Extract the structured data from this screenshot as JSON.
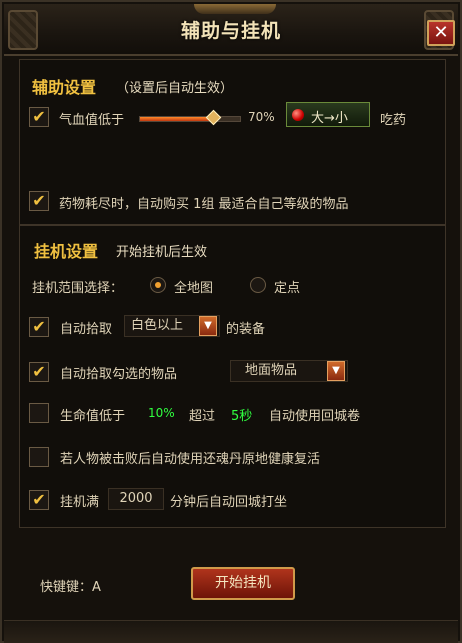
{
  "window": {
    "title": "辅助与挂机",
    "close_glyph": "✕"
  },
  "assist": {
    "section_title": "辅助设置",
    "section_note": "（设置后自动生效）",
    "hp_label": "气血值低于",
    "hp_value": "70%",
    "hp_level": 0.7,
    "order_button": "大→小",
    "take_label": "吃药",
    "buy_label": "药物耗尽时，自动购买 1组 最适合自己等级的物品",
    "check_glyph": "✔"
  },
  "idle": {
    "section_title": "挂机设置",
    "section_note": "开始挂机后生效",
    "range_label": "挂机范围选择：",
    "range_options": [
      "全地图",
      "定点"
    ],
    "range_selected": "全地图",
    "pickup_label": "自动拾取",
    "pickup_quality": "白色以上",
    "pickup_suffix": "的装备",
    "pickup_checked_label": "自动拾取勾选的物品",
    "ground_items": "地面物品",
    "life_label": "生命值低于",
    "life_value": "10%",
    "exceed_label": "超过",
    "exceed_value": "5秒",
    "life_action": "自动使用回城卷",
    "revive_label": "若人物被击败后自动使用还魂丹原地健康复活",
    "full_label": "挂机满",
    "full_minutes": "2000",
    "full_action": "分钟后自动回城打坐"
  },
  "footer": {
    "hotkey_label": "快键键：A",
    "start_button": "开始挂机"
  },
  "icons": {
    "dropdown": "▼"
  }
}
